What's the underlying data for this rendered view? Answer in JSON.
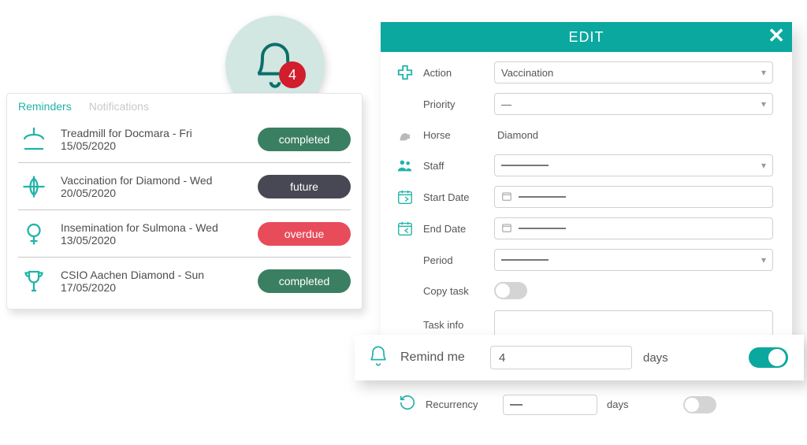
{
  "bell": {
    "count": "4"
  },
  "tabs": {
    "reminders": "Reminders",
    "notifications": "Notifications"
  },
  "reminders": [
    {
      "text": "Treadmill for Docmara - Fri 15/05/2020",
      "status": "completed",
      "icon": "treadmill"
    },
    {
      "text": "Vaccination for Diamond  - Wed 20/05/2020",
      "status": "future",
      "icon": "medical"
    },
    {
      "text": "Insemination for Sulmona - Wed 13/05/2020",
      "status": "overdue",
      "icon": "repro"
    },
    {
      "text": "CSIO Aachen Diamond - Sun 17/05/2020",
      "status": "completed",
      "icon": "trophy"
    }
  ],
  "status_labels": {
    "completed": "completed",
    "future": "future",
    "overdue": "overdue"
  },
  "edit": {
    "title": "EDIT",
    "labels": {
      "action": "Action",
      "priority": "Priority",
      "horse": "Horse",
      "staff": "Staff",
      "start_date": "Start Date",
      "end_date": "End Date",
      "period": "Period",
      "copy_task": "Copy task",
      "task_info": "Task info",
      "remind_me": "Remind me",
      "days": "days",
      "recurrency": "Recurrency"
    },
    "values": {
      "action": "Vaccination",
      "priority": "—",
      "horse": "Diamond",
      "staff": "",
      "period": "",
      "remind_me": "4",
      "recurrency": "—"
    },
    "toggles": {
      "copy_task": false,
      "remind_me": true,
      "recurrency": false
    }
  }
}
